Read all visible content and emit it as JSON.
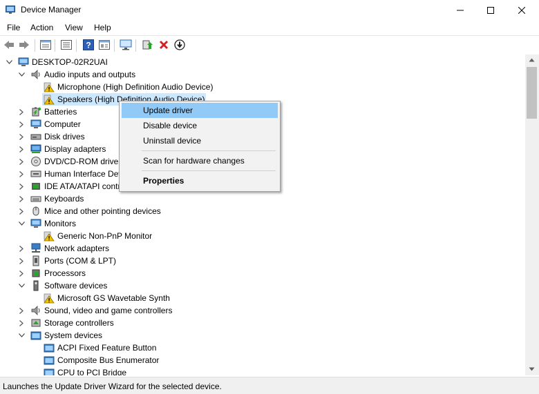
{
  "window": {
    "title": "Device Manager"
  },
  "menu": [
    "File",
    "Action",
    "View",
    "Help"
  ],
  "toolbar_icons": [
    "back-arrow-icon",
    "forward-arrow-icon",
    "properties-icon",
    "list-icon",
    "help-icon",
    "view-icon",
    "monitor-scan-icon",
    "add-driver-icon",
    "uninstall-x-icon",
    "download-circle-icon"
  ],
  "tree": {
    "root": "DESKTOP-02R2UAI",
    "rows": [
      {
        "label": "Audio inputs and outputs",
        "icon": "speaker-icon",
        "level": 1,
        "expand": "open"
      },
      {
        "label": "Microphone (High Definition Audio Device)",
        "icon": "warning-icon",
        "level": 2
      },
      {
        "label": "Speakers (High Definition Audio Device)",
        "icon": "warning-icon",
        "level": 2,
        "selected": true
      },
      {
        "label": "Batteries",
        "icon": "battery-icon",
        "level": 1,
        "expand": "closed"
      },
      {
        "label": "Computer",
        "icon": "computer-icon",
        "level": 1,
        "expand": "closed"
      },
      {
        "label": "Disk drives",
        "icon": "disk-drive-icon",
        "level": 1,
        "expand": "closed"
      },
      {
        "label": "Display adapters",
        "icon": "display-adapter-icon",
        "level": 1,
        "expand": "closed"
      },
      {
        "label": "DVD/CD-ROM drives",
        "icon": "dvd-icon",
        "level": 1,
        "expand": "closed"
      },
      {
        "label": "Human Interface Devices",
        "icon": "hid-icon",
        "level": 1,
        "expand": "closed"
      },
      {
        "label": "IDE ATA/ATAPI controllers",
        "icon": "ide-controller-icon",
        "level": 1,
        "expand": "closed"
      },
      {
        "label": "Keyboards",
        "icon": "keyboard-icon",
        "level": 1,
        "expand": "closed"
      },
      {
        "label": "Mice and other pointing devices",
        "icon": "mouse-icon",
        "level": 1,
        "expand": "closed"
      },
      {
        "label": "Monitors",
        "icon": "monitor-icon",
        "level": 1,
        "expand": "open"
      },
      {
        "label": "Generic Non-PnP Monitor",
        "icon": "warning-icon",
        "level": 2
      },
      {
        "label": "Network adapters",
        "icon": "network-icon",
        "level": 1,
        "expand": "closed"
      },
      {
        "label": "Ports (COM & LPT)",
        "icon": "port-icon",
        "level": 1,
        "expand": "closed"
      },
      {
        "label": "Processors",
        "icon": "processor-icon",
        "level": 1,
        "expand": "closed"
      },
      {
        "label": "Software devices",
        "icon": "software-device-icon",
        "level": 1,
        "expand": "open"
      },
      {
        "label": "Microsoft GS Wavetable Synth",
        "icon": "warning-icon",
        "level": 2
      },
      {
        "label": "Sound, video and game controllers",
        "icon": "speaker-icon",
        "level": 1,
        "expand": "closed"
      },
      {
        "label": "Storage controllers",
        "icon": "storage-icon",
        "level": 1,
        "expand": "closed"
      },
      {
        "label": "System devices",
        "icon": "system-folder-icon",
        "level": 1,
        "expand": "open"
      },
      {
        "label": "ACPI Fixed Feature Button",
        "icon": "system-device-icon",
        "level": 2
      },
      {
        "label": "Composite Bus Enumerator",
        "icon": "system-device-icon",
        "level": 2
      },
      {
        "label": "CPU to PCI Bridge",
        "icon": "system-device-icon",
        "level": 2
      }
    ]
  },
  "context_menu": {
    "items": [
      {
        "label": "Update driver",
        "highlighted": true
      },
      {
        "label": "Disable device"
      },
      {
        "label": "Uninstall device"
      },
      {
        "separator": true
      },
      {
        "label": "Scan for hardware changes"
      },
      {
        "separator": true
      },
      {
        "label": "Properties",
        "bold": true
      }
    ]
  },
  "status": {
    "text": "Launches the Update Driver Wizard for the selected device."
  },
  "colors": {
    "selection": "#cce8ff",
    "menu_highlight": "#91c9f7",
    "warning": "#f2c200"
  }
}
